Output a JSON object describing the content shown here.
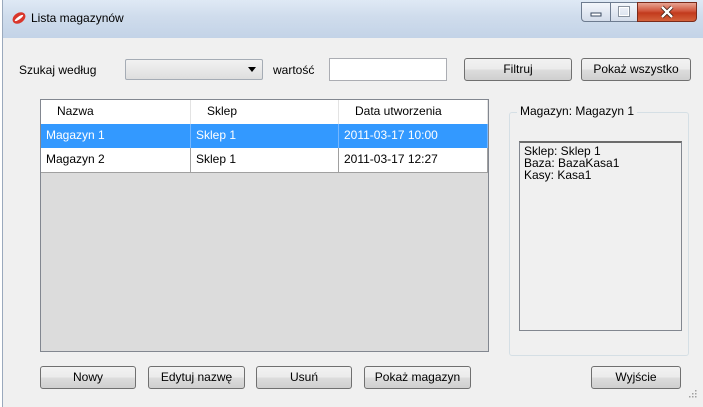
{
  "window": {
    "title": "Lista magazynów"
  },
  "filter": {
    "search_by_label": "Szukaj według",
    "combo_value": "",
    "value_label": "wartość",
    "value_input": "",
    "filter_button": "Filtruj",
    "show_all_button": "Pokaż wszystko"
  },
  "grid": {
    "columns": [
      "Nazwa",
      "Sklep",
      "Data utworzenia"
    ],
    "rows": [
      [
        "Magazyn 1",
        "Sklep 1",
        "2011-03-17 10:00"
      ],
      [
        "Magazyn 2",
        "Sklep 1",
        "2011-03-17 12:27"
      ]
    ]
  },
  "details": {
    "group_title": "Magazyn: Magazyn 1",
    "lines": [
      "Sklep: Sklep 1",
      "Baza: BazaKasa1",
      "Kasy: Kasa1"
    ]
  },
  "buttons": {
    "new": "Nowy",
    "rename": "Edytuj nazwę",
    "delete": "Usuń",
    "show_store": "Pokaż magazyn",
    "exit": "Wyjście"
  },
  "colors": {
    "selection": "#3399ff",
    "close_button": "#c94a2f"
  }
}
